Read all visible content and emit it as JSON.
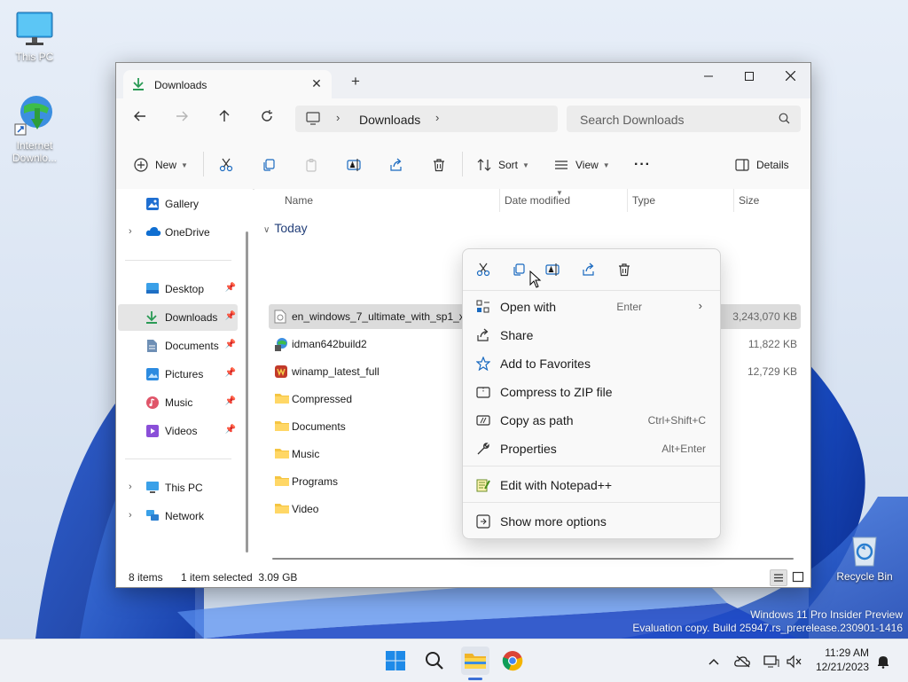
{
  "desktop": {
    "icons": [
      {
        "label": "This PC"
      },
      {
        "label": "Internet Downlo..."
      },
      {
        "label": "Recycle Bin"
      }
    ],
    "watermark": {
      "line1": "Windows 11 Pro Insider Preview",
      "line2": "Evaluation copy. Build 25947.rs_prerelease.230901-1416"
    }
  },
  "window": {
    "tab": {
      "label": "Downloads"
    },
    "address": {
      "location": "Downloads"
    },
    "search": {
      "placeholder": "Search Downloads"
    },
    "toolbar": {
      "new_label": "New",
      "sort_label": "Sort",
      "view_label": "View",
      "more_label": "···",
      "details_label": "Details"
    },
    "sidebar": {
      "items": [
        {
          "label": "Gallery"
        },
        {
          "label": "OneDrive"
        },
        {
          "label": "Desktop"
        },
        {
          "label": "Downloads"
        },
        {
          "label": "Documents"
        },
        {
          "label": "Pictures"
        },
        {
          "label": "Music"
        },
        {
          "label": "Videos"
        },
        {
          "label": "This PC"
        },
        {
          "label": "Network"
        }
      ]
    },
    "columns": {
      "name": "Name",
      "date": "Date modified",
      "type": "Type",
      "size": "Size"
    },
    "group": "Today",
    "files": [
      {
        "name": "en_windows_7_ultimate_with_sp1_x6",
        "size": "3,243,070 KB"
      },
      {
        "name": "idman642build2",
        "size": "11,822 KB"
      },
      {
        "name": "winamp_latest_full",
        "size": "12,729 KB"
      },
      {
        "name": "Compressed",
        "size": ""
      },
      {
        "name": "Documents",
        "size": ""
      },
      {
        "name": "Music",
        "size": ""
      },
      {
        "name": "Programs",
        "size": ""
      },
      {
        "name": "Video",
        "size": ""
      }
    ],
    "status": {
      "count": "8 items",
      "selection": "1 item selected  3.09 GB"
    }
  },
  "context_menu": {
    "items": [
      {
        "label": "Open with",
        "shortcut": "Enter"
      },
      {
        "label": "Share",
        "shortcut": ""
      },
      {
        "label": "Add to Favorites",
        "shortcut": ""
      },
      {
        "label": "Compress to ZIP file",
        "shortcut": ""
      },
      {
        "label": "Copy as path",
        "shortcut": "Ctrl+Shift+C"
      },
      {
        "label": "Properties",
        "shortcut": "Alt+Enter"
      },
      {
        "label": "Edit with Notepad++",
        "shortcut": ""
      },
      {
        "label": "Show more options",
        "shortcut": ""
      }
    ]
  },
  "taskbar": {
    "time": "11:29 AM",
    "date": "12/21/2023"
  },
  "colors": {
    "accent": "#0067c0",
    "folder": "#f5c542",
    "selection": "#dcdcdc",
    "taskbar": "#eef1f6"
  }
}
